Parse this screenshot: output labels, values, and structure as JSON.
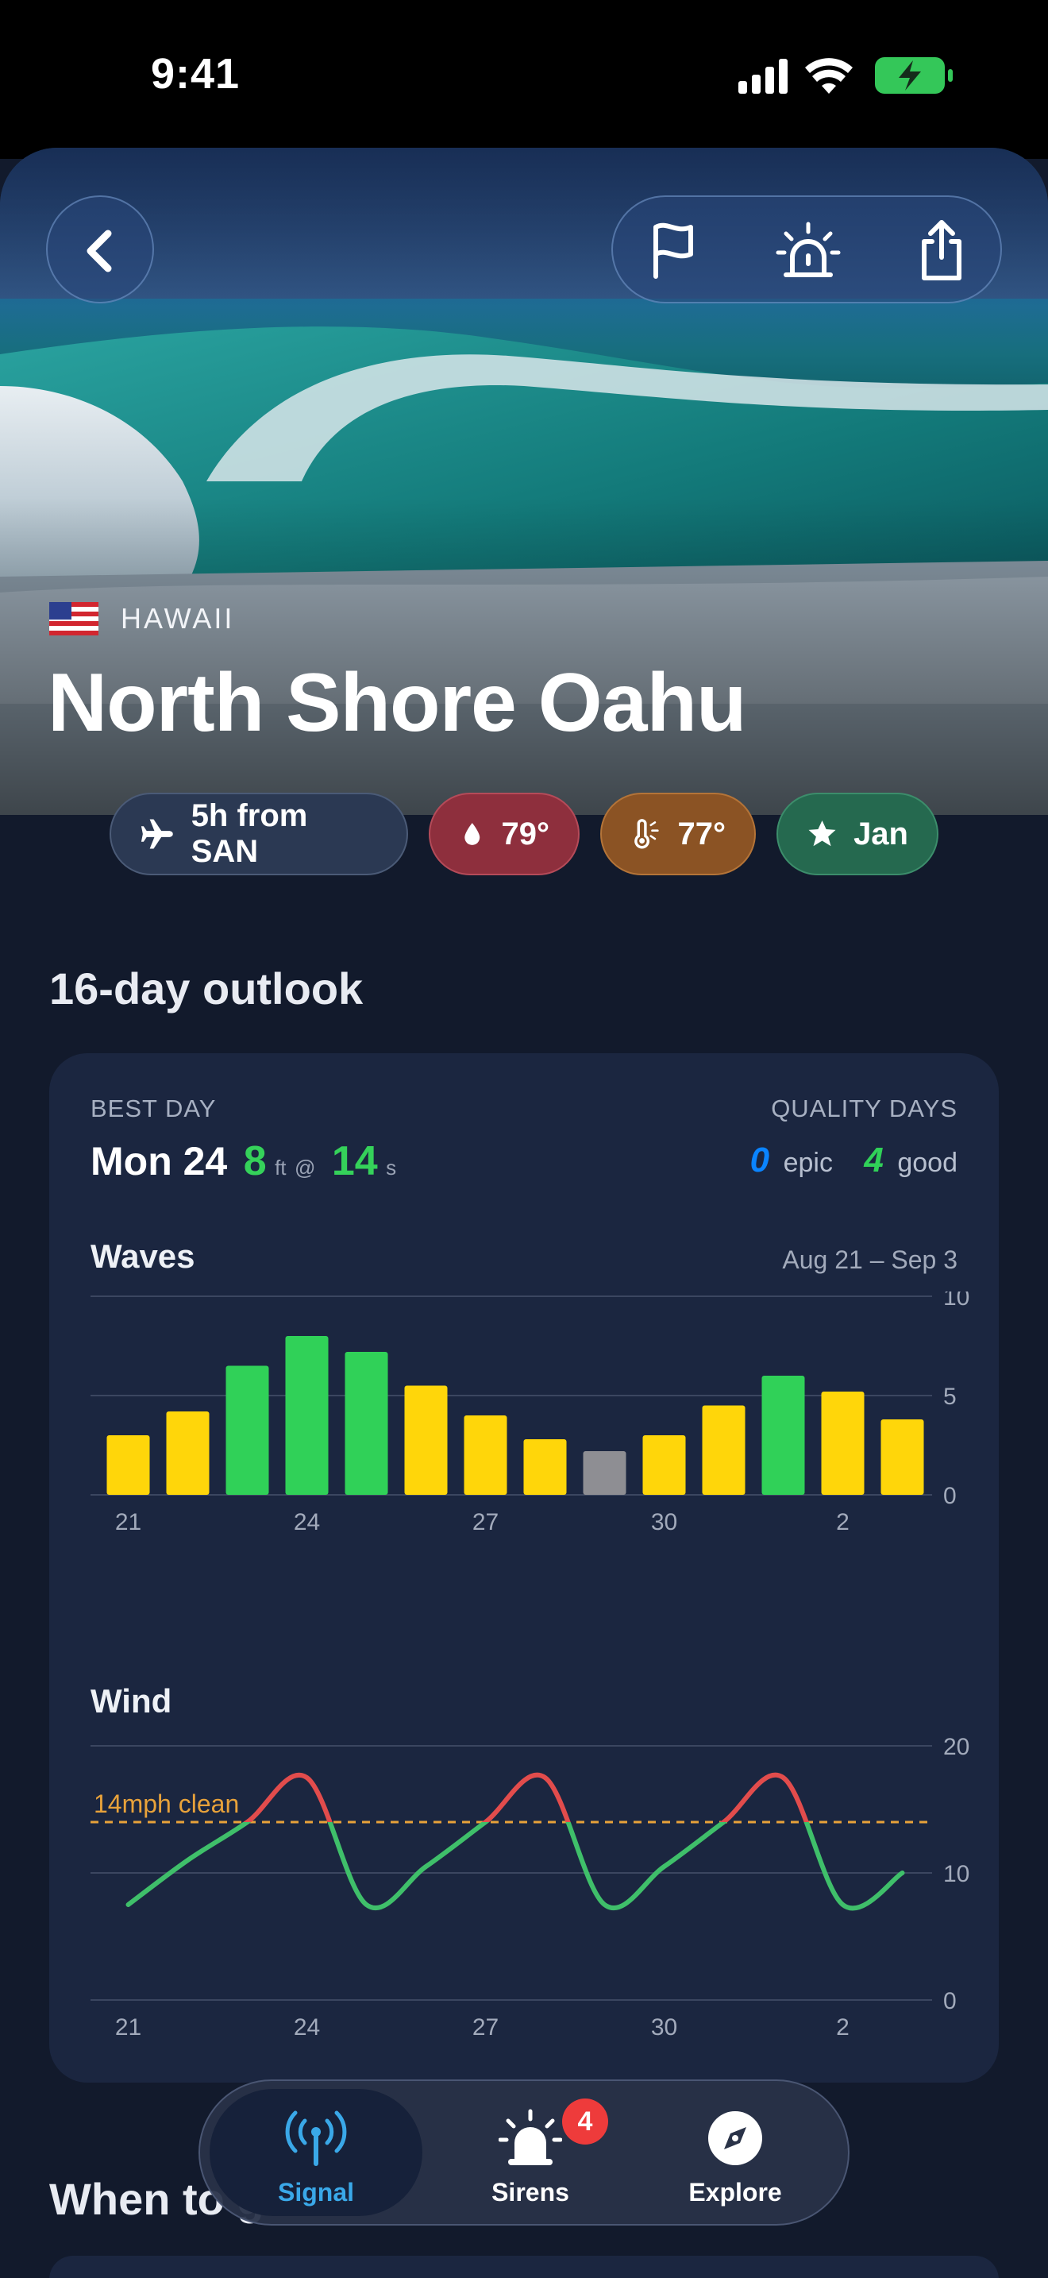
{
  "status_bar": {
    "time": "9:41"
  },
  "header": {
    "back_icon": "chevron-left-icon",
    "actions": [
      "flag-icon",
      "siren-icon",
      "share-icon"
    ]
  },
  "spot": {
    "flag": "us-flag",
    "region": "HAWAII",
    "name": "North Shore Oahu"
  },
  "chips": {
    "travel": {
      "icon": "airplane-icon",
      "label": "5h from SAN"
    },
    "water": {
      "icon": "water-drop-icon",
      "label": "79°"
    },
    "air": {
      "icon": "thermometer-sun-icon",
      "label": "77°"
    },
    "season": {
      "icon": "star-icon",
      "label": "Jan"
    }
  },
  "outlook": {
    "title": "16-day outlook",
    "best_day_label": "BEST DAY",
    "best_day": "Mon 24",
    "best_height": "8",
    "height_unit": "ft",
    "at": "@",
    "best_period": "14",
    "period_unit": "s",
    "quality_label": "QUALITY DAYS",
    "epic_count": "0",
    "epic_label": "epic",
    "good_count": "4",
    "good_label": "good"
  },
  "chart_data": [
    {
      "type": "bar",
      "title": "Waves",
      "subtitle": "Aug 21 – Sep 3",
      "categories": [
        "21",
        "22",
        "23",
        "24",
        "25",
        "26",
        "27",
        "28",
        "29",
        "30",
        "31",
        "1",
        "2",
        "3"
      ],
      "values": [
        3.0,
        4.2,
        6.5,
        8.0,
        7.2,
        5.5,
        4.0,
        2.8,
        2.2,
        3.0,
        4.5,
        6.0,
        5.2,
        3.8
      ],
      "quality": [
        "fair",
        "fair",
        "good",
        "good",
        "good",
        "fair",
        "fair",
        "fair",
        "poor",
        "fair",
        "fair",
        "good",
        "fair",
        "fair"
      ],
      "quality_colors": {
        "good": "#30d158",
        "fair": "#ffd60a",
        "poor": "#8e8e93"
      },
      "ylim": [
        0,
        10
      ],
      "yticks": [
        0,
        5,
        10
      ],
      "xtick_labels": [
        "21",
        "24",
        "27",
        "30",
        "2"
      ],
      "grid": true
    },
    {
      "type": "line",
      "title": "Wind",
      "x": [
        "21",
        "22",
        "23",
        "24",
        "25",
        "26",
        "27",
        "28",
        "29",
        "30",
        "31",
        "1",
        "2",
        "3"
      ],
      "y": [
        7.5,
        11,
        14,
        17.5,
        7.5,
        10.5,
        14,
        17.5,
        7.5,
        10.5,
        14,
        17.5,
        7.5,
        10
      ],
      "threshold": 14,
      "threshold_label": "14mph clean",
      "below_color": "#3fbf6a",
      "above_color": "#e24c4c",
      "threshold_color": "#e8a23a",
      "ylim": [
        0,
        20
      ],
      "yticks": [
        0,
        10,
        20
      ],
      "xtick_labels": [
        "21",
        "24",
        "27",
        "30",
        "2"
      ],
      "grid": true
    }
  ],
  "tabs": [
    {
      "label": "Signal",
      "icon": "signal-antenna-icon",
      "active": true
    },
    {
      "label": "Sirens",
      "icon": "siren-icon",
      "badge": "4"
    },
    {
      "label": "Explore",
      "icon": "compass-icon"
    }
  ],
  "next_section": {
    "title": "When to go"
  }
}
